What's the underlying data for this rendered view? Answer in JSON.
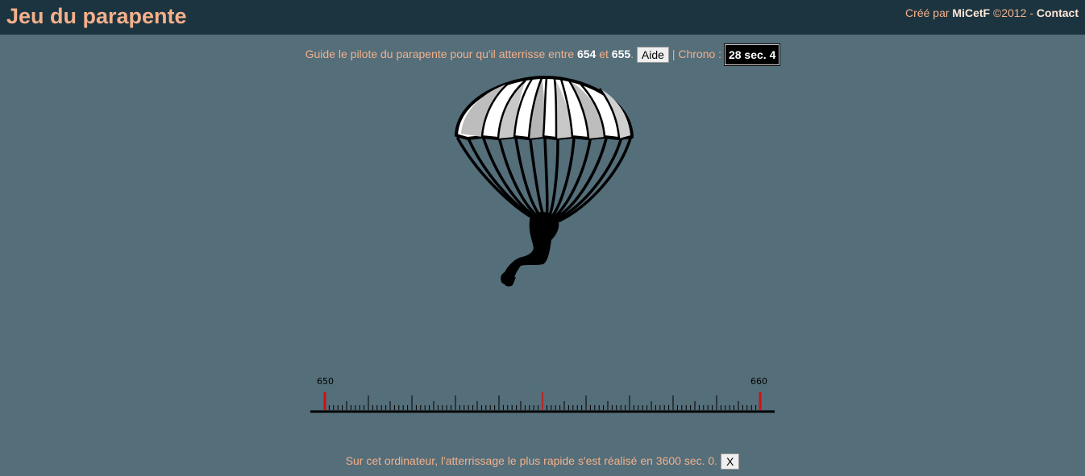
{
  "header": {
    "title": "Jeu du parapente",
    "credits_prefix": "Créé par",
    "author": "MiCetF",
    "year_text": "©2012 -",
    "contact": "Contact"
  },
  "instruction": {
    "prefix": "Guide le pilote du parapente pour qu'il atterrisse entre",
    "low": "654",
    "connector": "et",
    "high": "655",
    "period": ".",
    "help_button": "Aide",
    "chrono_label": "| Chrono :",
    "chrono_value": "28 sec. 4"
  },
  "ruler": {
    "min_label": "650",
    "max_label": "660",
    "min": 650,
    "max": 660,
    "marker_colour": "#cc1111"
  },
  "record": {
    "text": "Sur cet ordinateur, l'atterrissage le plus rapide s'est réalisé en 3600 sec. 0.",
    "close_button": "X"
  },
  "colors": {
    "background": "#546e7a",
    "header_bg": "#1c3440",
    "accent": "#f4b08a"
  }
}
